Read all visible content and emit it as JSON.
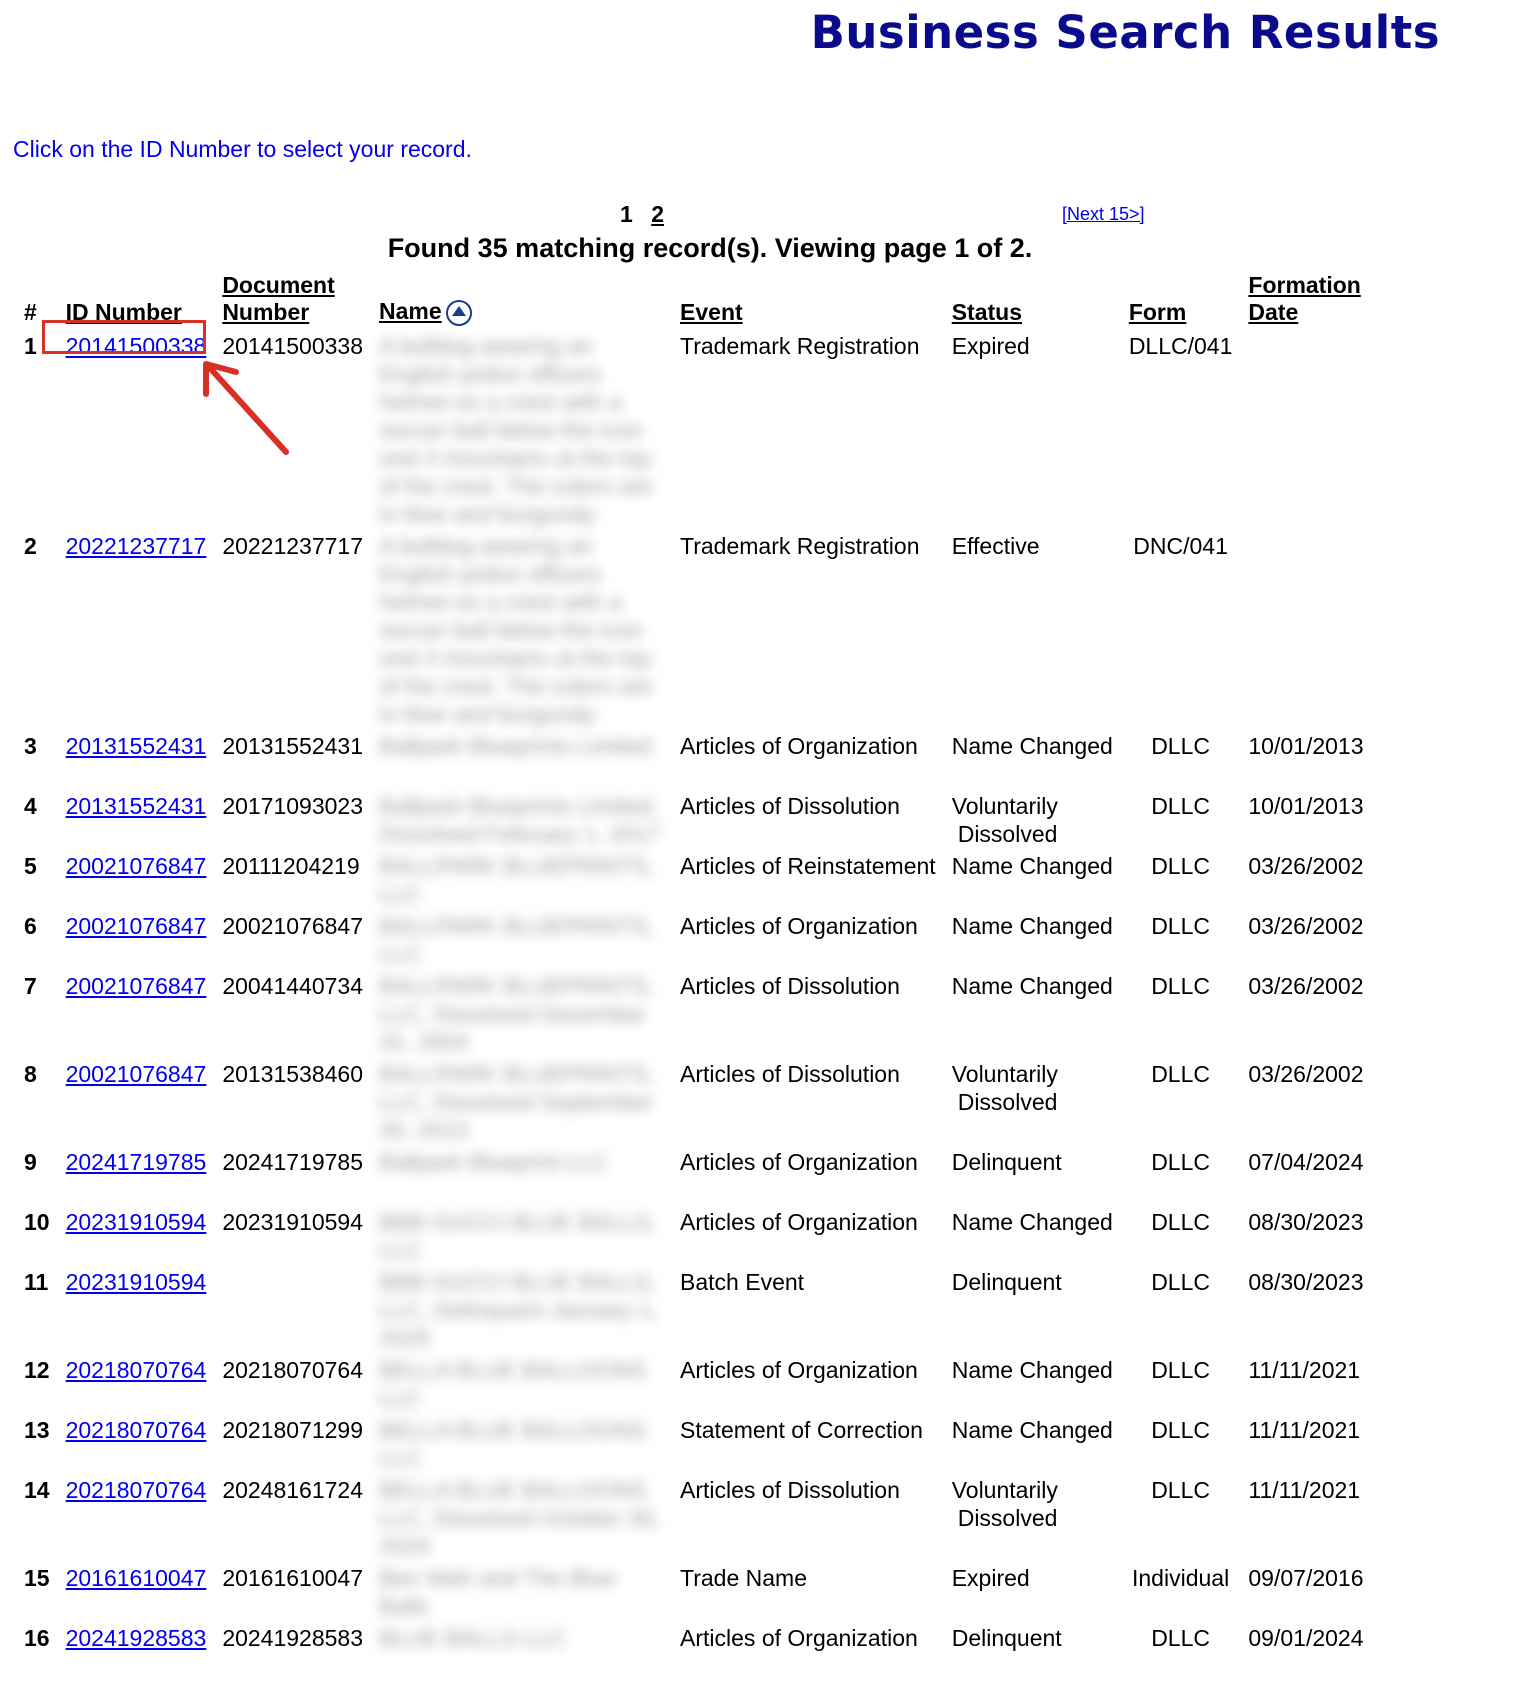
{
  "page": {
    "title": "Business Search Results",
    "instruction": "Click on the ID Number to select your record.",
    "pagination": {
      "pages": [
        "1",
        "2"
      ],
      "next_label": "[Next 15>]"
    },
    "found_text": "Found 35 matching record(s).  Viewing page 1 of 2."
  },
  "table": {
    "headers": {
      "num": "#",
      "id": "ID Number",
      "doc1": "Document",
      "doc2": "Number",
      "name": "Name",
      "event": "Event",
      "status": "Status",
      "form": "Form",
      "date1": "Formation",
      "date2": "Date"
    },
    "rows": [
      {
        "num": "1",
        "id": "20141500338",
        "doc": "20141500338",
        "name": "A bulldog wearing an English police officers helmet on a crest with a soccer ball below the icon and 3 mountains at the top of the crest. The colors are in blue and burgundy.",
        "event": "Trademark Registration",
        "status": "Expired",
        "status2": "",
        "form": "DLLC/041",
        "date": ""
      },
      {
        "num": "2",
        "id": "20221237717",
        "doc": "20221237717",
        "name": "A bulldog wearing an English police officers helmet on a crest with a soccer ball below the icon and 3 mountains at the top of the crest. The colors are in blue and burgundy.",
        "event": "Trademark Registration",
        "status": "Effective",
        "status2": "",
        "form": "DNC/041",
        "date": ""
      },
      {
        "num": "3",
        "id": "20131552431",
        "doc": "20131552431",
        "name": "Ballpark Blueprints Limited",
        "event": "Articles of Organization",
        "status": "Name Changed",
        "status2": "",
        "form": "DLLC",
        "date": "10/01/2013"
      },
      {
        "num": "4",
        "id": "20131552431",
        "doc": "20171093023",
        "name": "Ballpark Blueprints Limited, Dissolved February 1, 2017",
        "event": "Articles of Dissolution",
        "status": "Voluntarily",
        "status2": "Dissolved",
        "form": "DLLC",
        "date": "10/01/2013"
      },
      {
        "num": "5",
        "id": "20021076847",
        "doc": "20111204219",
        "name": "BALLPARK BLUEPRINTS, LLC",
        "event": "Articles of Reinstatement",
        "status": "Name Changed",
        "status2": "",
        "form": "DLLC",
        "date": "03/26/2002"
      },
      {
        "num": "6",
        "id": "20021076847",
        "doc": "20021076847",
        "name": "BALLPARK BLUEPRINTS, LLC",
        "event": "Articles of Organization",
        "status": "Name Changed",
        "status2": "",
        "form": "DLLC",
        "date": "03/26/2002"
      },
      {
        "num": "7",
        "id": "20021076847",
        "doc": "20041440734",
        "name": "BALLPARK BLUEPRINTS, LLC, Dissolved December 31, 2004",
        "event": "Articles of Dissolution",
        "status": "Name Changed",
        "status2": "",
        "form": "DLLC",
        "date": "03/26/2002"
      },
      {
        "num": "8",
        "id": "20021076847",
        "doc": "20131538460",
        "name": "BALLPARK BLUEPRINTS, LLC, Dissolved September 30, 2013",
        "event": "Articles of Dissolution",
        "status": "Voluntarily",
        "status2": "Dissolved",
        "form": "DLLC",
        "date": "03/26/2002"
      },
      {
        "num": "9",
        "id": "20241719785",
        "doc": "20241719785",
        "name": "Ballpark Blueprint LLC",
        "event": "Articles of Organization",
        "status": "Delinquent",
        "status2": "",
        "form": "DLLC",
        "date": "07/04/2024"
      },
      {
        "num": "10",
        "id": "20231910594",
        "doc": "20231910594",
        "name": "BBB GUCCI BLUE BALLS, LLC",
        "event": "Articles of Organization",
        "status": "Name Changed",
        "status2": "",
        "form": "DLLC",
        "date": "08/30/2023"
      },
      {
        "num": "11",
        "id": "20231910594",
        "doc": "",
        "name": "BBB GUCCI BLUE BALLS, LLC, Delinquent January 1, 2025",
        "event": "Batch Event",
        "status": "Delinquent",
        "status2": "",
        "form": "DLLC",
        "date": "08/30/2023"
      },
      {
        "num": "12",
        "id": "20218070764",
        "doc": "20218070764",
        "name": "BELLA BLUE BALLOONS LLC",
        "event": "Articles of Organization",
        "status": "Name Changed",
        "status2": "",
        "form": "DLLC",
        "date": "11/11/2021"
      },
      {
        "num": "13",
        "id": "20218070764",
        "doc": "20218071299",
        "name": "BELLA BLUE BALLOONS LLC",
        "event": "Statement of Correction",
        "status": "Name Changed",
        "status2": "",
        "form": "DLLC",
        "date": "11/11/2021"
      },
      {
        "num": "14",
        "id": "20218070764",
        "doc": "20248161724",
        "name": "BELLA BLUE BALLOONS LLC, Dissolved October 30, 2024",
        "event": "Articles of Dissolution",
        "status": "Voluntarily",
        "status2": "Dissolved",
        "form": "DLLC",
        "date": "11/11/2021"
      },
      {
        "num": "15",
        "id": "20161610047",
        "doc": "20161610047",
        "name": "Ben Wah and The Blue Balls",
        "event": "Trade Name",
        "status": "Expired",
        "status2": "",
        "form": "Individual",
        "date": "09/07/2016"
      },
      {
        "num": "16",
        "id": "20241928583",
        "doc": "20241928583",
        "name": "BLUE BALLS LLC",
        "event": "Articles of Organization",
        "status": "Delinquent",
        "status2": "",
        "form": "DLLC",
        "date": "09/01/2024"
      }
    ]
  },
  "colors": {
    "title": "#0a0a8c",
    "link": "#0000ee",
    "highlight": "#d93025"
  },
  "icons": {
    "sort": "sort-ascending-icon",
    "annotation": "arrow-annotation-icon"
  }
}
